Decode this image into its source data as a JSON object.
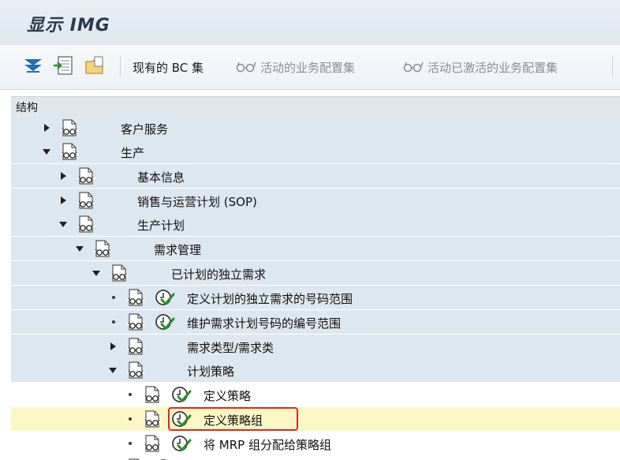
{
  "window": {
    "title": "显示 IMG"
  },
  "toolbar": {
    "existing_bc_sets": "现有的 BC 集",
    "active_business_config_sets": "活动的业务配置集",
    "activated_business_config_sets": "活动已激活的业务配置集"
  },
  "structure": {
    "header": "结构",
    "nodes": [
      {
        "label": "客户服务",
        "state": "collapsed"
      },
      {
        "label": "生产",
        "state": "expanded"
      },
      {
        "label": "基本信息",
        "state": "collapsed"
      },
      {
        "label": "销售与运营计划 (SOP)",
        "state": "collapsed"
      },
      {
        "label": "生产计划",
        "state": "expanded"
      },
      {
        "label": "需求管理",
        "state": "expanded"
      },
      {
        "label": "已计划的独立需求",
        "state": "expanded"
      },
      {
        "label": "定义计划的独立需求的号码范围",
        "state": "leaf"
      },
      {
        "label": "维护需求计划号码的编号范围",
        "state": "leaf"
      },
      {
        "label": "需求类型/需求类",
        "state": "collapsed"
      },
      {
        "label": "计划策略",
        "state": "expanded"
      },
      {
        "label": "定义策略",
        "state": "leaf"
      },
      {
        "label": "定义策略组",
        "state": "leaf",
        "selected": true
      },
      {
        "label": "将 MRP 组分配给策略组",
        "state": "leaf"
      }
    ]
  }
}
